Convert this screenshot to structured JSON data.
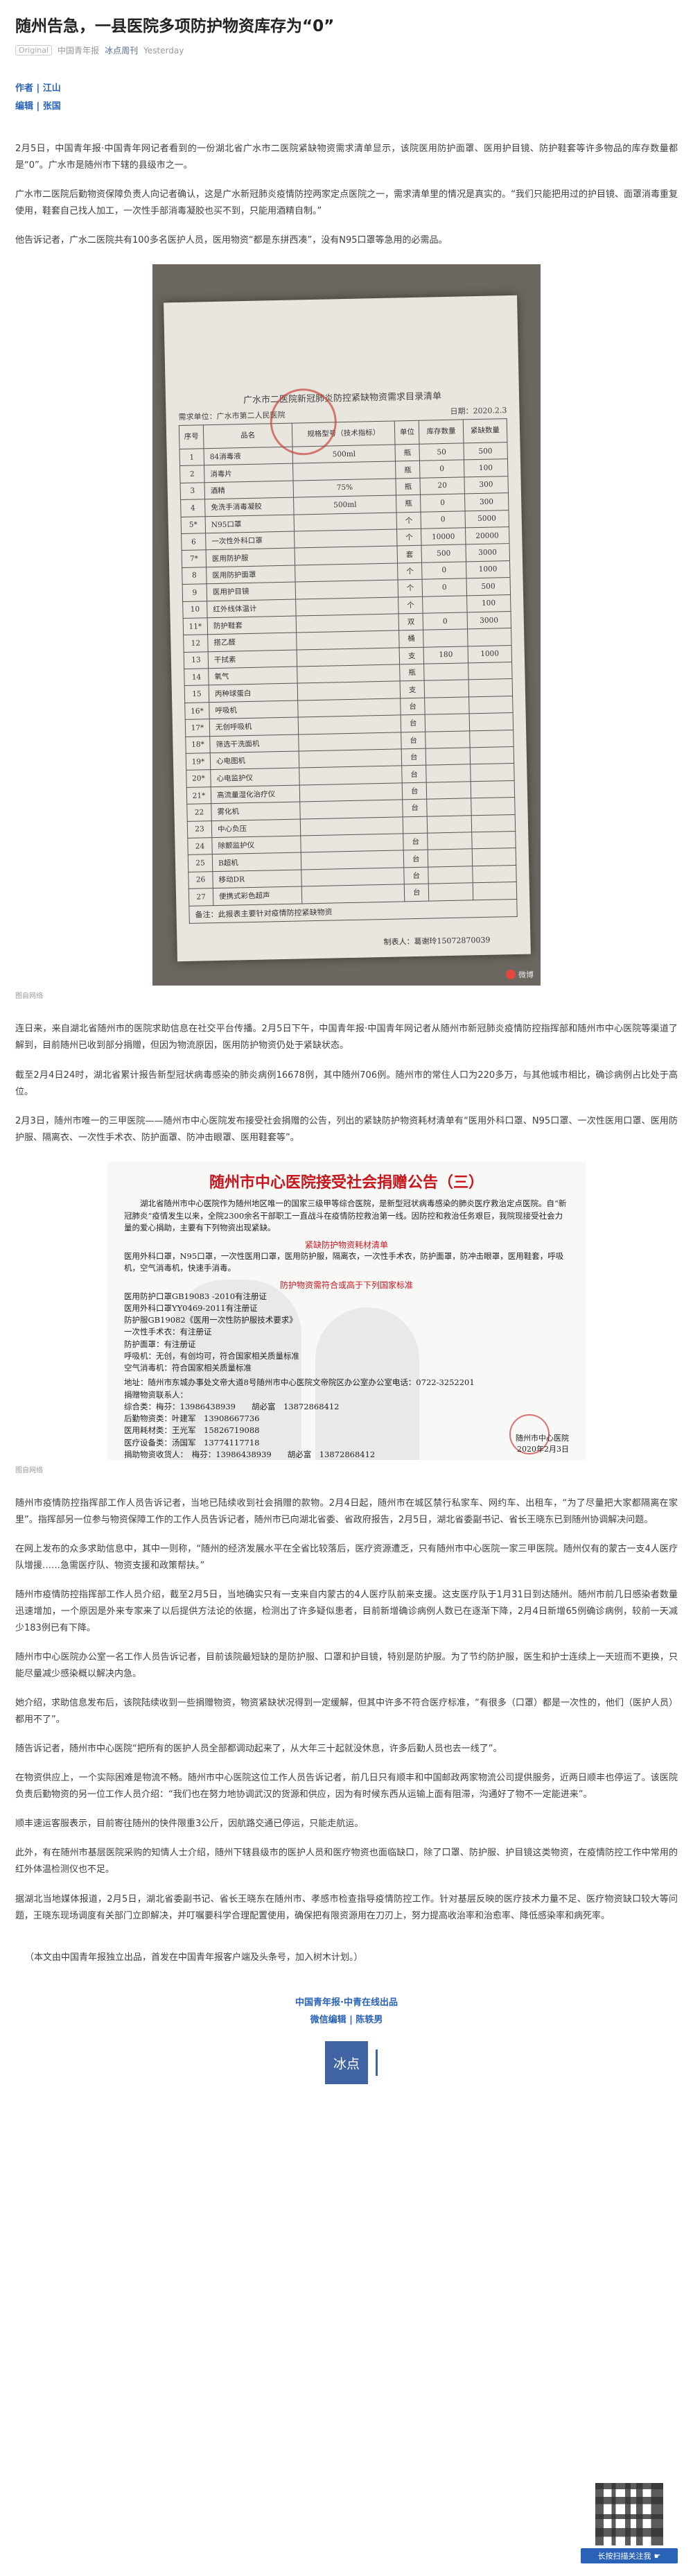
{
  "article": {
    "title": "随州告急，一县医院多项防护物资库存为“0”",
    "original_tag": "Original",
    "source": "中国青年报",
    "account": "冰点周刊",
    "time": "Yesterday"
  },
  "credits": {
    "author": "作者 | 江山",
    "editor": "编辑 | 张国"
  },
  "paragraphs": {
    "p1": "2月5日，中国青年报·中国青年网记者看到的一份湖北省广水市二医院紧缺物资需求清单显示，该院医用防护面罩、医用护目镜、防护鞋套等许多物品的库存数量都是“0”。广水市是随州市下辖的县级市之一。",
    "p2": "广水市二医院后勤物资保障负责人向记者确认，这是广水新冠肺炎疫情防控两家定点医院之一，需求清单里的情况是真实的。“我们只能把用过的护目镜、面罩消毒重复使用，鞋套自己找人加工，一次性手部消毒凝胶也买不到，只能用酒精自制。”",
    "p3": "他告诉记者，广水二医院共有100多名医护人员，医用物资“都是东拼西凑”，没有N95口罩等急用的必需品。",
    "p4": "连日来，来自湖北省随州市的医院求助信息在社交平台传播。2月5日下午，中国青年报·中国青年网记者从随州市新冠肺炎疫情防控指挥部和随州市中心医院等渠道了解到，目前随州已收到部分捐赠，但因为物流原因，医用防护物资仍处于紧缺状态。",
    "p5": "截至2月4日24时，湖北省累计报告新型冠状病毒感染的肺炎病例16678例，其中随州706例。随州市的常住人口为220多万，与其他城市相比，确诊病例占比处于高位。",
    "p6": "2月3日，随州市唯一的三甲医院——随州市中心医院发布接受社会捐赠的公告，列出的紧缺防护物资耗材清单有“医用外科口罩、N95口罩、一次性医用口罩、医用防护服、隔离衣、一次性手术衣、防护面罩、防冲击眼罩、医用鞋套等”。",
    "p7": "随州市疫情防控指挥部工作人员告诉记者，当地已陆续收到社会捐赠的款物。2月4日起，随州市在城区禁行私家车、网约车、出租车，“为了尽量把大家都隔离在家里”。指挥部另一位参与物资保障工作的工作人员告诉记者，随州市已向湖北省委、省政府报告，2月5日，湖北省委副书记、省长王晓东已到随州协调解决问题。",
    "p8": "在网上发布的众多求助信息中，其中一则称，“随州的经济发展水平在全省比较落后，医疗资源遭乏，只有随州市中心医院一家三甲医院。随州仅有的蒙古一支4人医疗队增援……急需医疗队、物资支援和政策帮扶。”",
    "p9": "随州市疫情防控指挥部工作人员介绍，截至2月5日，当地确实只有一支来自内蒙古的4人医疗队前来支援。这支医疗队于1月31日到达随州。随州市前几日感染者数量迅速增加，一个原因是外来专家来了以后提供方法论的依据，检测出了许多疑似患者，目前新增确诊病例人数已在逐渐下降，2月4日新增65例确诊病例，较前一天减少183例已有下降。",
    "p10": "随州市中心医院办公室一名工作人员告诉记者，目前该院最短缺的是防护服、口罩和护目镜，特别是防护服。为了节约防护服，医生和护士连续上一天班而不更换，只能尽量减少感染概以解决内急。",
    "p11": "她介绍，求助信息发布后，该院陆续收到一些捐赠物资，物资紧缺状况得到一定缓解，但其中许多不符合医疗标准，“有很多（口罩）都是一次性的，他们（医护人员）都用不了”。",
    "p12": "随告诉记者，随州市中心医院“把所有的医护人员全部都调动起来了，从大年三十起就没休息，许多后勤人员也去一线了”。",
    "p13": "在物资供应上，一个实际困难是物流不畅。随州市中心医院这位工作人员告诉记者，前几日只有顺丰和中国邮政两家物流公司提供服务，近两日顺丰也停运了。该医院负责后勤物资的另一位工作人员介绍：“我们也在努力地协调武汉的货源和供应，因为有时候东西从运输上面有阻滞，沟通好了物不一定能进来”。",
    "p14": "顺丰速运客服表示，目前寄往随州的快件限重3公斤，因航路交通已停运，只能走航运。",
    "p15": "此外，有在随州市基层医院采购的知情人士介绍，随州下辖县级市的医护人员和医疗物资也面临缺口，除了口罩、防护服、护目镜这类物资，在疫情防控工作中常用的红外体温检测仪也不足。",
    "p16": "据湖北当地媒体报道，2月5日，湖北省委副书记、省长王晓东在随州市、孝感市检查指导疫情防控工作。针对基层反映的医疗技术力量不足、医疗物资缺口较大等问题，王晓东现场调度有关部门立即解决，并叮嘱要科学合理配置使用，确保把有限资源用在刀刃上，努力提高收治率和治愈率、降低感染率和病死率。",
    "end_note": "（本文由中国青年报独立出品，首发在中国青年报客户端及头条号，加入树木计划。）"
  },
  "doc_image": {
    "caption": "图自网络",
    "title": "广水市二医院新冠肺炎防控紧缺物资需求目录清单",
    "unit_label": "需求单位：广水市第二人民医院",
    "date_label": "日期：2020.2.3",
    "headers": [
      "序号",
      "品名",
      "规格型号（技术指标）",
      "单位",
      "库存数量",
      "紧缺数量"
    ],
    "rows": [
      [
        "1",
        "84消毒液",
        "500ml",
        "瓶",
        "50",
        "500"
      ],
      [
        "2",
        "消毒片",
        "",
        "瓶",
        "0",
        "100"
      ],
      [
        "3",
        "酒精",
        "75%",
        "瓶",
        "20",
        "300"
      ],
      [
        "4",
        "免洗手消毒凝胶",
        "500ml",
        "瓶",
        "0",
        "300"
      ],
      [
        "5*",
        "N95口罩",
        "",
        "个",
        "0",
        "5000"
      ],
      [
        "6",
        "一次性外科口罩",
        "",
        "个",
        "10000",
        "20000"
      ],
      [
        "7*",
        "医用防护服",
        "",
        "套",
        "500",
        "3000"
      ],
      [
        "8",
        "医用防护面罩",
        "",
        "个",
        "0",
        "1000"
      ],
      [
        "9",
        "医用护目镜",
        "",
        "个",
        "0",
        "500"
      ],
      [
        "10",
        "红外线体温计",
        "",
        "个",
        "",
        "100"
      ],
      [
        "11*",
        "防护鞋套",
        "",
        "双",
        "0",
        "3000"
      ],
      [
        "12",
        "搭乙醛",
        "",
        "桶",
        "",
        ""
      ],
      [
        "13",
        "干拭素",
        "",
        "支",
        "180",
        "1000"
      ],
      [
        "14",
        "氧气",
        "",
        "瓶",
        "",
        ""
      ],
      [
        "15",
        "丙种球蛋白",
        "",
        "支",
        "",
        ""
      ],
      [
        "16*",
        "呼吸机",
        "",
        "台",
        "",
        ""
      ],
      [
        "17*",
        "无创呼吸机",
        "",
        "台",
        "",
        ""
      ],
      [
        "18*",
        "筛选干洗面机",
        "",
        "台",
        "",
        ""
      ],
      [
        "19*",
        "心电图机",
        "",
        "台",
        "",
        ""
      ],
      [
        "20*",
        "心电监护仪",
        "",
        "台",
        "",
        ""
      ],
      [
        "21*",
        "高流量湿化治疗仪",
        "",
        "台",
        "",
        ""
      ],
      [
        "22",
        "雾化机",
        "",
        "台",
        "",
        ""
      ],
      [
        "23",
        "中心负压",
        "",
        "",
        "",
        ""
      ],
      [
        "24",
        "除颤监护仪",
        "",
        "台",
        "",
        ""
      ],
      [
        "25",
        "B超机",
        "",
        "台",
        "",
        ""
      ],
      [
        "26",
        "移动DR",
        "",
        "台",
        "",
        ""
      ],
      [
        "27",
        "便携式彩色超声",
        "",
        "台",
        "",
        ""
      ]
    ],
    "note": "备注：此报表主要针对疫情防控紧缺物资",
    "signer": "制表人：葛谢玲15072870039",
    "watermark": "微博"
  },
  "notice_image": {
    "caption": "图自网络",
    "title": "随州市中心医院接受社会捐赠公告（三）",
    "intro": "湖北省随州市中心医院作为随州地区唯一的国家三级甲等综合医院，是新型冠状病毒感染的肺炎医疗救治定点医院。自“新冠肺炎”疫情发生以来，全院2300余名干部职工一直战斗在疫情防控救治第一线。因防控和救治任务艰巨，我院现接受社会力量的爱心捐助，主要有下列物资出现紧缺。",
    "shortage_heading": "紧缺防护物资耗材清单",
    "shortage_list": "医用外科口罩，N95口罩，一次性医用口罩，医用防护服，隔离衣，一次性手术衣，防护面罩，防冲击眼罩，医用鞋套，呼吸机，空气消毒机，快速手消毒。",
    "standard_heading": "防护物资需符合或高于下列国家标准",
    "standards": "医用防护口罩GB19083 -2010有注册证\n医用外科口罩YY0469-2011有注册证\n防护服GB19082《医用一次性防护服技术要求》\n一次性手术衣：有注册证\n防护面罩：有注册证\n呼吸机：无创，有创均可，符合国家相关质量标准\n空气消毒机：符合国家相关质量标准",
    "address": "地址：随州市东城办事处文帝大道8号随州市中心医院文帝院区办公室办公室电话：0722-3252201",
    "contacts": "捐赠物资联系人：\n综合类：梅芬：13986438939　　胡必富　13872868412\n后勤物资类：叶建军　13908667736\n医用耗材类：王光军　15826719088\n医疗设备类：汤国军　13774117718\n捐助物资收货人：　梅芬：13986438939　　胡必富　13872868412",
    "sign_org": "随州市中心医院",
    "sign_date": "2020年2月3日"
  },
  "footer": {
    "line1": "中国青年报·中青在线出品",
    "line2": "微信编辑 | 陈轶男",
    "logo_text": "冰点",
    "qr_button": "长按扫描关注我"
  }
}
